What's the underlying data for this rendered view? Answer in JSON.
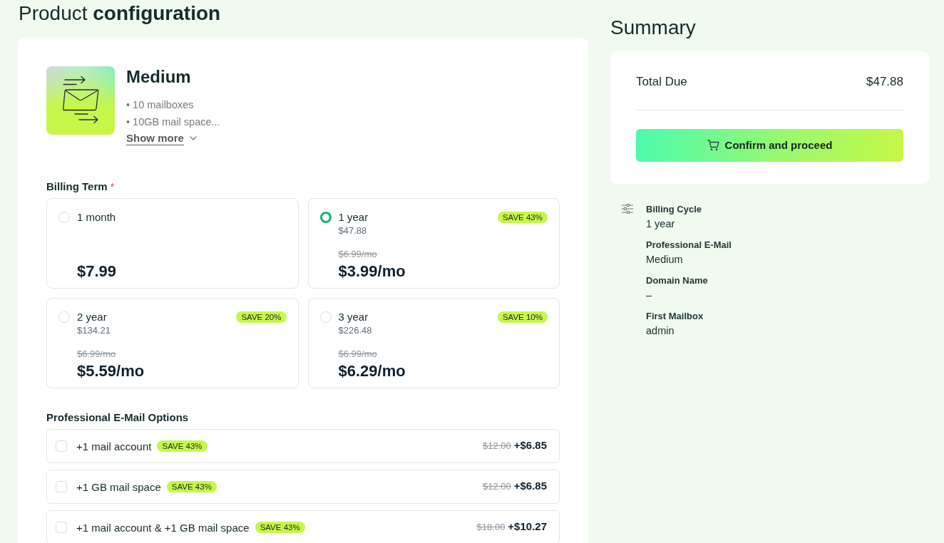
{
  "page_title": "Product **configuration**",
  "product": {
    "name": "Medium",
    "features": [
      "• 10 mailboxes",
      "• 10GB mail space..."
    ],
    "show_more": "Show more"
  },
  "billing_term": {
    "label": "Billing Term",
    "required_mark": "*",
    "options": [
      {
        "term": "1 month",
        "price": "$7.99",
        "selected": false
      },
      {
        "term": "1 year",
        "total": "$47.88",
        "old_price": "$6.99/mo",
        "price": "$3.99/mo",
        "badge": "SAVE 43%",
        "selected": true
      },
      {
        "term": "2 year",
        "total": "$134.21",
        "old_price": "$6.99/mo",
        "price": "$5.59/mo",
        "badge": "SAVE 20%",
        "selected": false
      },
      {
        "term": "3 year",
        "total": "$226.48",
        "old_price": "$6.99/mo",
        "price": "$6.29/mo",
        "badge": "SAVE 10%",
        "selected": false
      }
    ]
  },
  "email_options": {
    "title": "Professional E-Mail Options",
    "items": [
      {
        "label": "+1 mail account",
        "badge": "SAVE 43%",
        "old_price": "$12.00",
        "price": "+$6.85",
        "checked": false
      },
      {
        "label": "+1 GB mail space",
        "badge": "SAVE 43%",
        "old_price": "$12.00",
        "price": "+$6.85",
        "checked": false
      },
      {
        "label": "+1 mail account & +1 GB mail space",
        "badge": "SAVE 43%",
        "old_price": "$18.00",
        "price": "+$10.27",
        "checked": false
      }
    ]
  },
  "summary": {
    "title": "Summary",
    "total_label": "Total Due",
    "total_value": "$47.88",
    "confirm_button": "Confirm and proceed",
    "details": [
      {
        "label": "Billing Cycle",
        "value": "1 year"
      },
      {
        "label": "Professional E-Mail",
        "value": "Medium"
      },
      {
        "label": "Domain Name",
        "value": "–"
      },
      {
        "label": "First Mailbox",
        "value": "admin"
      }
    ]
  }
}
